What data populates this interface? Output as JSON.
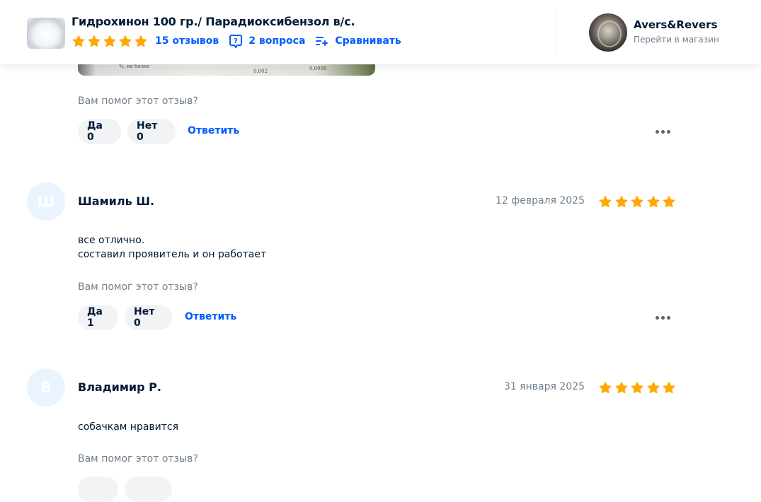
{
  "header": {
    "product_title": "Гидрохинон 100 гр./ Парадиоксибензол в/с.",
    "rating_stars": 5,
    "reviews_link": "15 отзывов",
    "questions_link": "2 вопроса",
    "compare_link": "Сравнивать",
    "shop_name": "Avers&Revers",
    "shop_link": "Перейти в магазин"
  },
  "colors": {
    "accent": "#005bff",
    "star": "#ffa800",
    "text": "#001a34",
    "muted": "#707f8d",
    "button_bg": "#f2f3f5",
    "avatar_bg": "#e9f4ff"
  },
  "reviews": [
    {
      "photo_text": [
        "%, не более",
        "0,002",
        "0,0008"
      ],
      "helped_prompt": "Вам помог этот отзыв?",
      "yes_label": "Да 0",
      "no_label": "Нет 0",
      "reply_label": "Ответить"
    },
    {
      "avatar_letter": "Ш",
      "author": "Шамиль Ш.",
      "date": "12 февраля 2025",
      "rating": 5,
      "text": "все отлично.\nсоставил проявитель и он работает",
      "helped_prompt": "Вам помог этот отзыв?",
      "yes_label": "Да 1",
      "no_label": "Нет 0",
      "reply_label": "Ответить"
    },
    {
      "avatar_letter": "В",
      "author": "Владимир Р.",
      "date": "31 января 2025",
      "rating": 5,
      "text": "собачкам нравится",
      "helped_prompt": "Вам помог этот отзыв?"
    }
  ]
}
